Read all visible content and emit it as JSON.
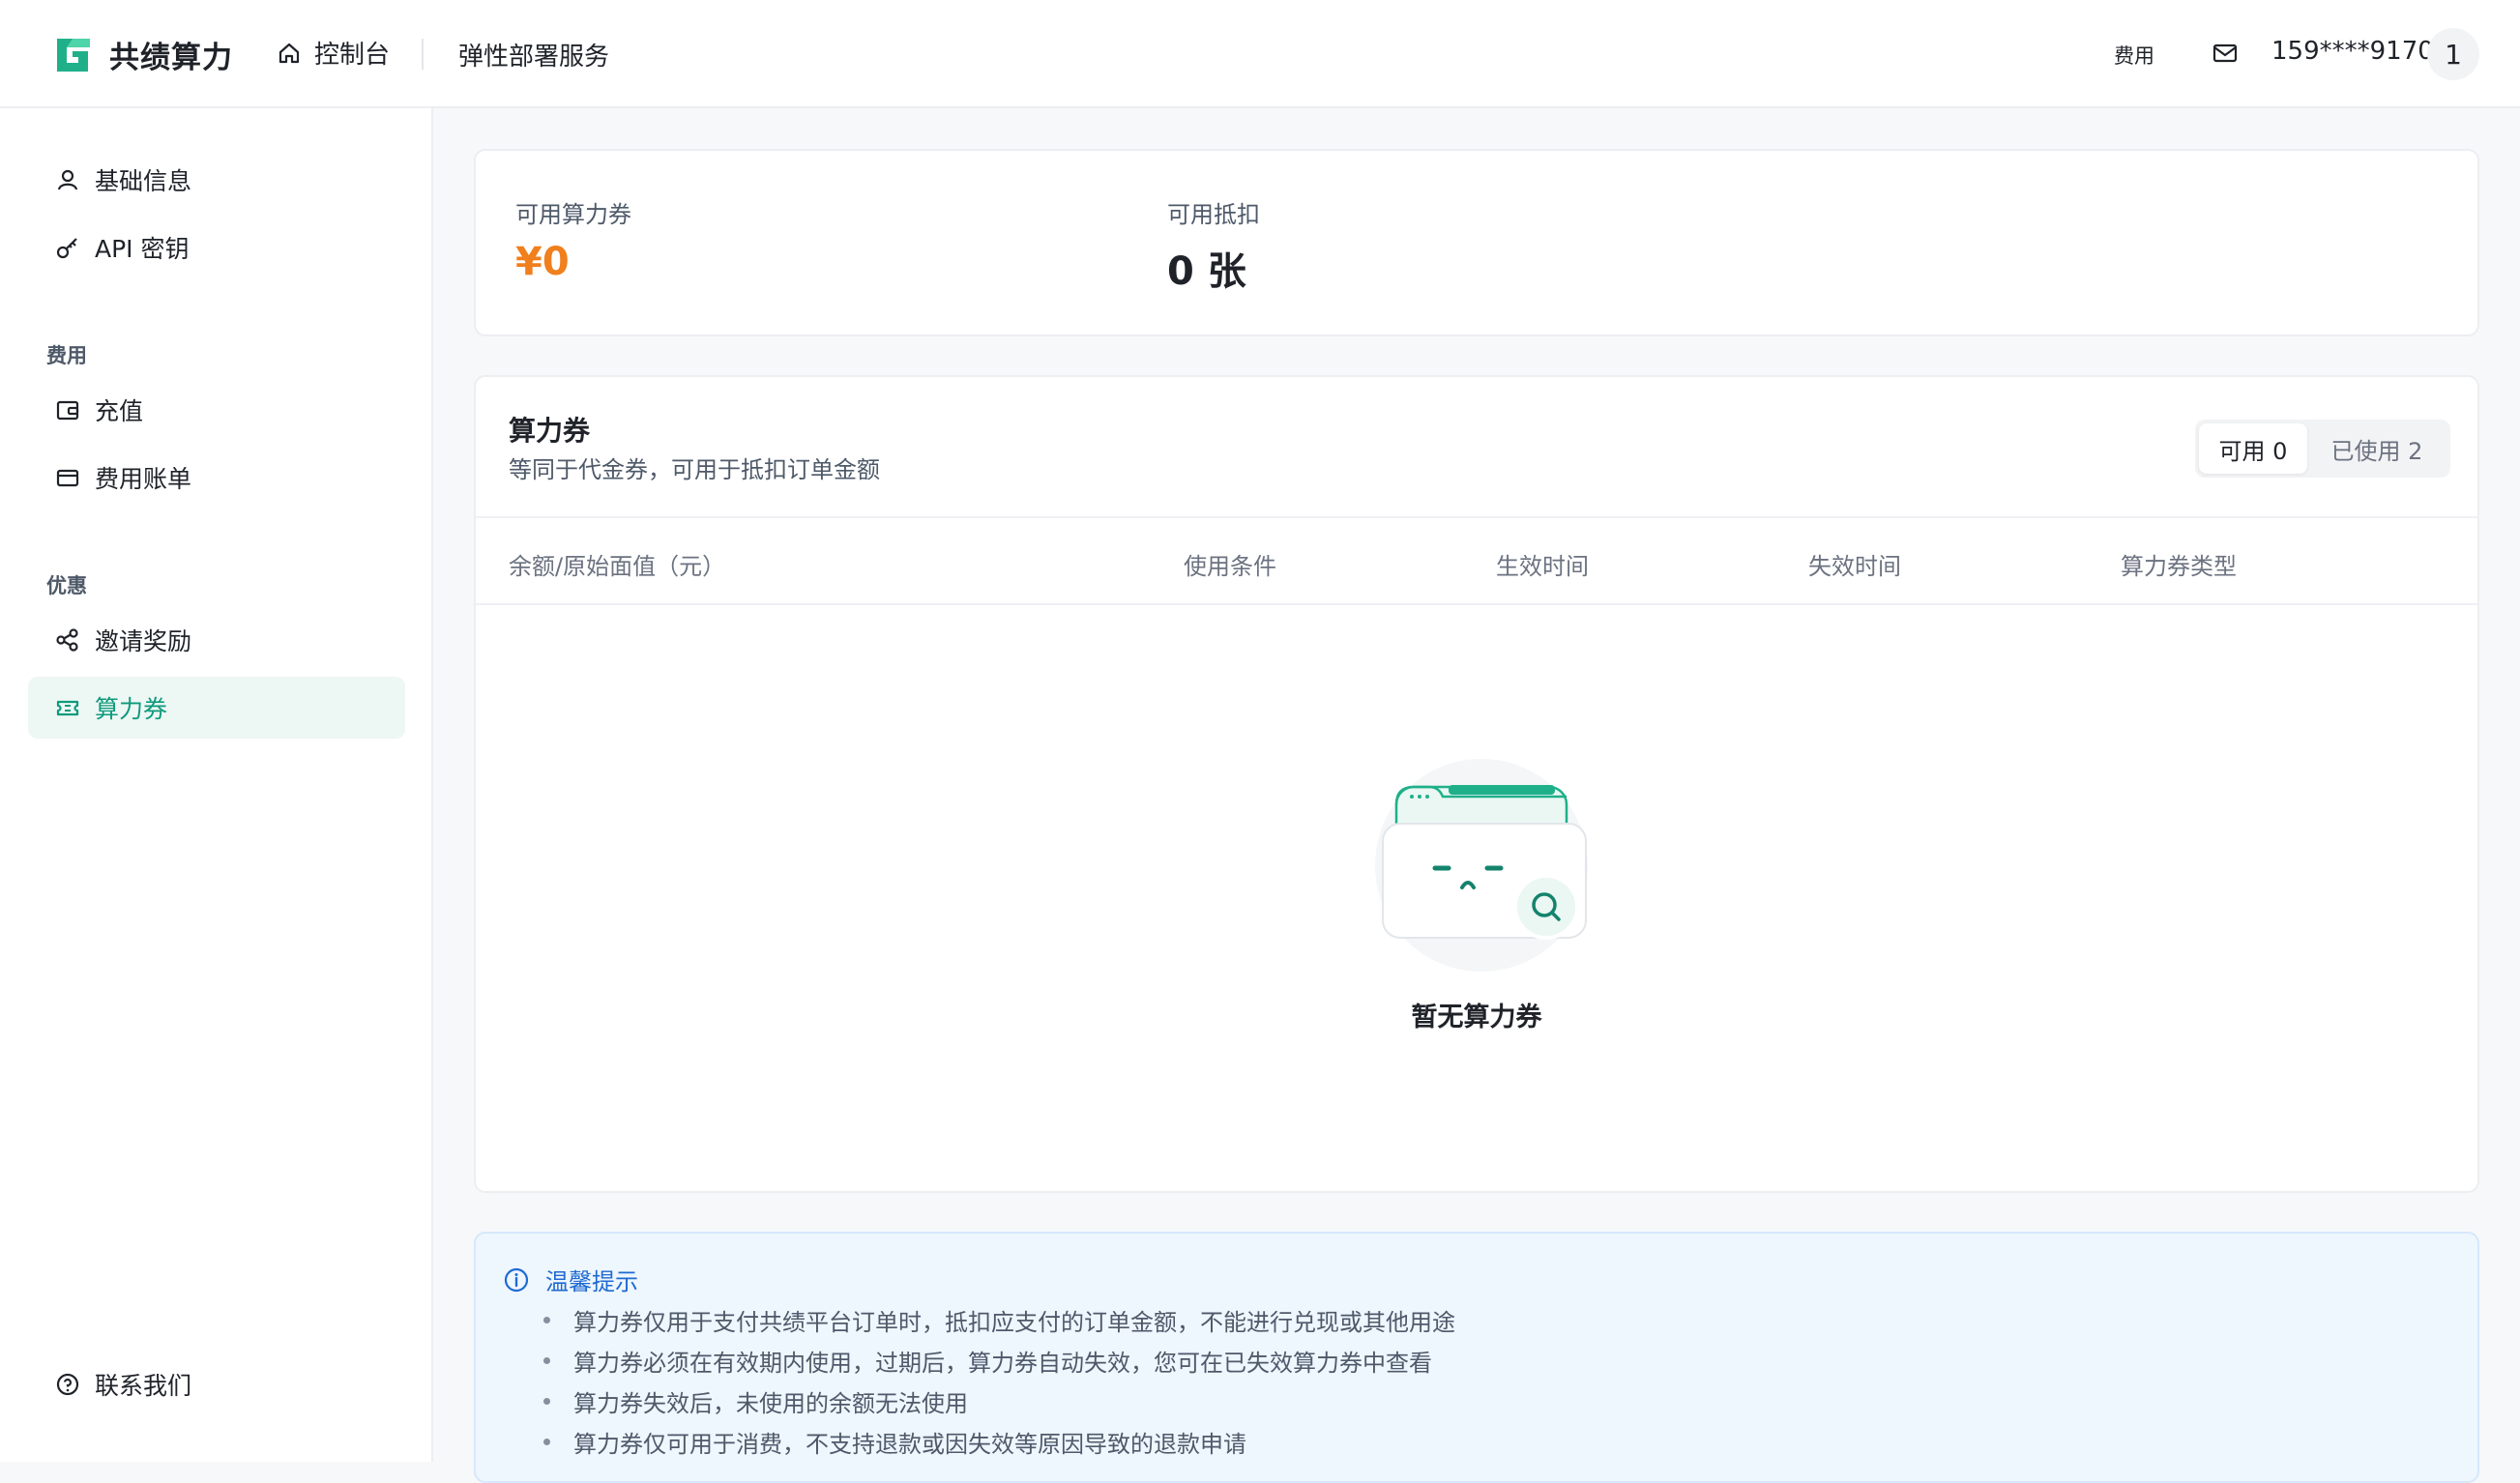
{
  "brand": {
    "name": "共绩算力",
    "accent": "#1fb08a"
  },
  "topbar": {
    "console_label": "控制台",
    "elastic_label": "弹性部署服务",
    "fee_label": "费用",
    "phone": "159****9170",
    "avatar_text": "1"
  },
  "sidebar": {
    "items_top": [
      {
        "label": "基础信息",
        "icon": "user-icon"
      },
      {
        "label": "API 密钥",
        "icon": "key-icon"
      }
    ],
    "group_fee": "费用",
    "items_fee": [
      {
        "label": "充值",
        "icon": "wallet-icon"
      },
      {
        "label": "费用账单",
        "icon": "card-icon"
      }
    ],
    "group_promo": "优惠",
    "items_promo": [
      {
        "label": "邀请奖励",
        "icon": "share-icon"
      },
      {
        "label": "算力券",
        "icon": "ticket-icon",
        "active": true
      }
    ],
    "contact_label": "联系我们"
  },
  "summary": {
    "available_label": "可用算力券",
    "available_value": "¥0",
    "deduct_label": "可用抵扣",
    "deduct_value": "0 张"
  },
  "coupon": {
    "title": "算力券",
    "subtitle": "等同于代金券，可用于抵扣订单金额",
    "tab_available": "可用 0",
    "tab_used": "已使用 2",
    "columns": [
      "余额/原始面值（元）",
      "使用条件",
      "生效时间",
      "失效时间",
      "算力券类型"
    ],
    "empty_text": "暂无算力券"
  },
  "tips": {
    "title": "温馨提示",
    "items": [
      "算力券仅用于支付共绩平台订单时，抵扣应支付的订单金额，不能进行兑现或其他用途",
      "算力券必须在有效期内使用，过期后，算力券自动失效，您可在已失效算力券中查看",
      "算力券失效后，未使用的余额无法使用",
      "算力券仅可用于消费，不支持退款或因失效等原因导致的退款申请"
    ]
  },
  "colors": {
    "orange": "#f07f1d",
    "green": "#0f9a7c",
    "blue": "#1f6ad1"
  }
}
